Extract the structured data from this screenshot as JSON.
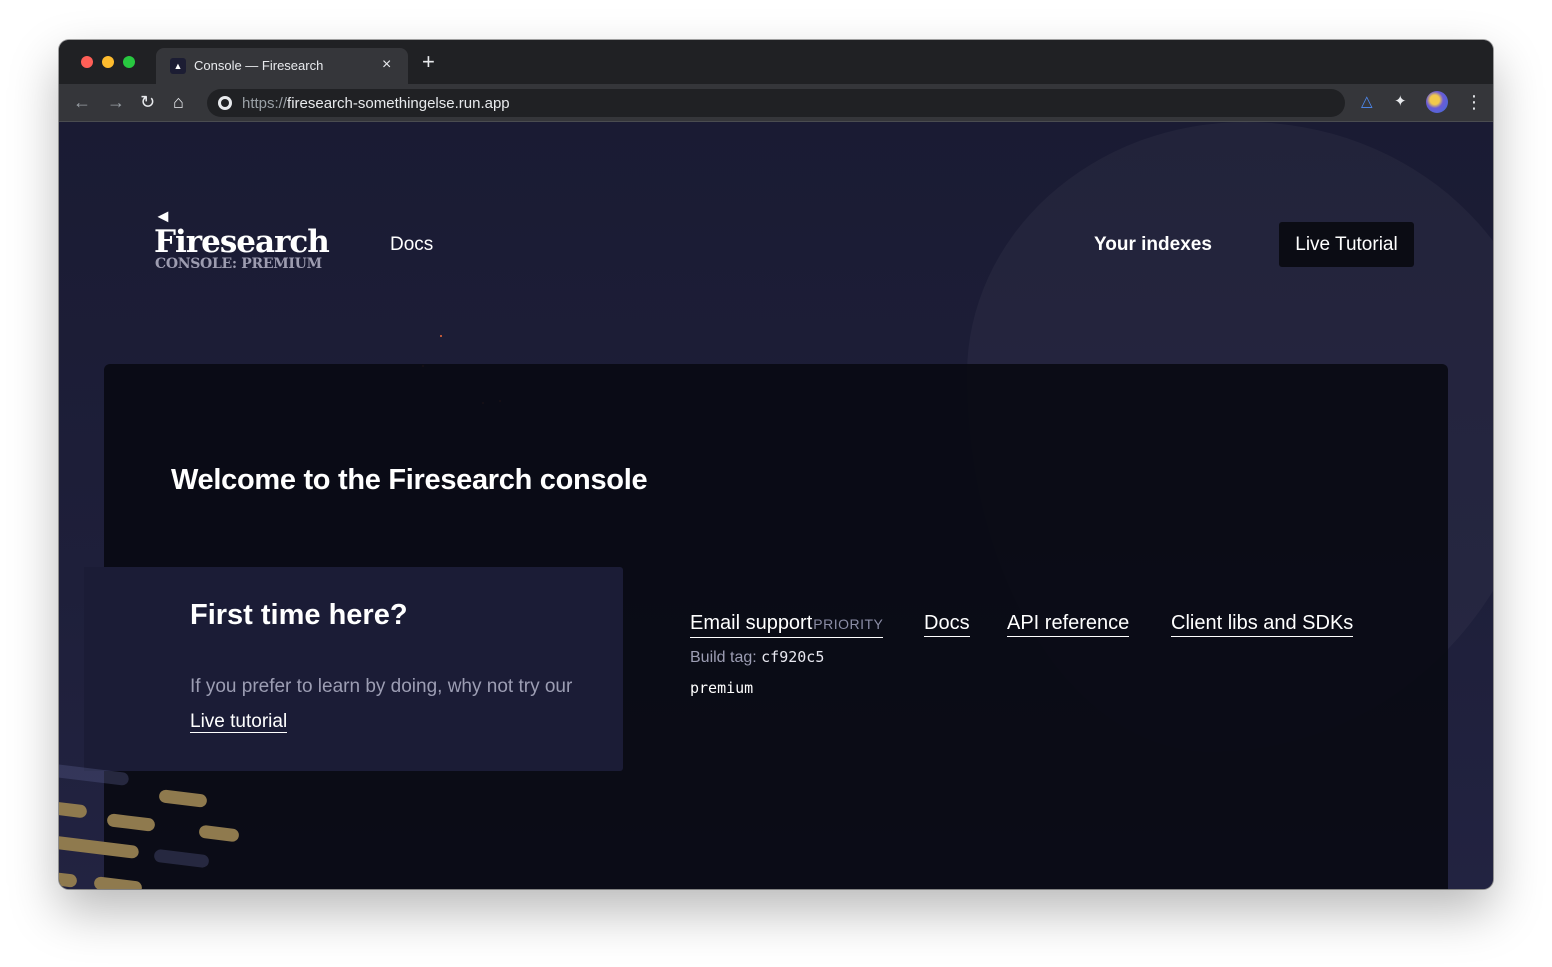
{
  "browser": {
    "tab_title": "Console — Firesearch",
    "tab_favicon": "flame-icon",
    "tab_close": "×",
    "new_tab": "+",
    "url_scheme": "https://",
    "url_host": "firesearch-somethingelse.run.app",
    "icons": [
      "back-arrow-icon",
      "forward-arrow-icon",
      "reload-icon",
      "home-icon",
      "site-info-icon",
      "extension-icon",
      "puzzle-icon",
      "profile-avatar",
      "kebab-menu-icon"
    ]
  },
  "header": {
    "logo_word": "Firesearch",
    "logo_sub": "CONSOLE: PREMIUM",
    "nav_docs": "Docs",
    "nav_indexes": "Your indexes",
    "nav_tutorial": "Live Tutorial"
  },
  "main": {
    "welcome": "Welcome to the Firesearch console",
    "card": {
      "title": "First time here?",
      "text": "If you prefer to learn by doing, why not try our ",
      "link": "Live tutorial"
    },
    "links": {
      "email": "Email support",
      "email_badge": "PRIORITY",
      "docs": "Docs",
      "api": "API reference",
      "sdk": "Client libs and SDKs"
    },
    "build_label": "Build tag: ",
    "build_tag": "cf920c5",
    "plan": "premium"
  },
  "colors": {
    "page_bg": "#1c1d33",
    "panel_bg": "#0a0b14",
    "card_bg": "#1b1c36",
    "accent_spark": "#f06a3a",
    "muted_text": "#9c9db3"
  }
}
